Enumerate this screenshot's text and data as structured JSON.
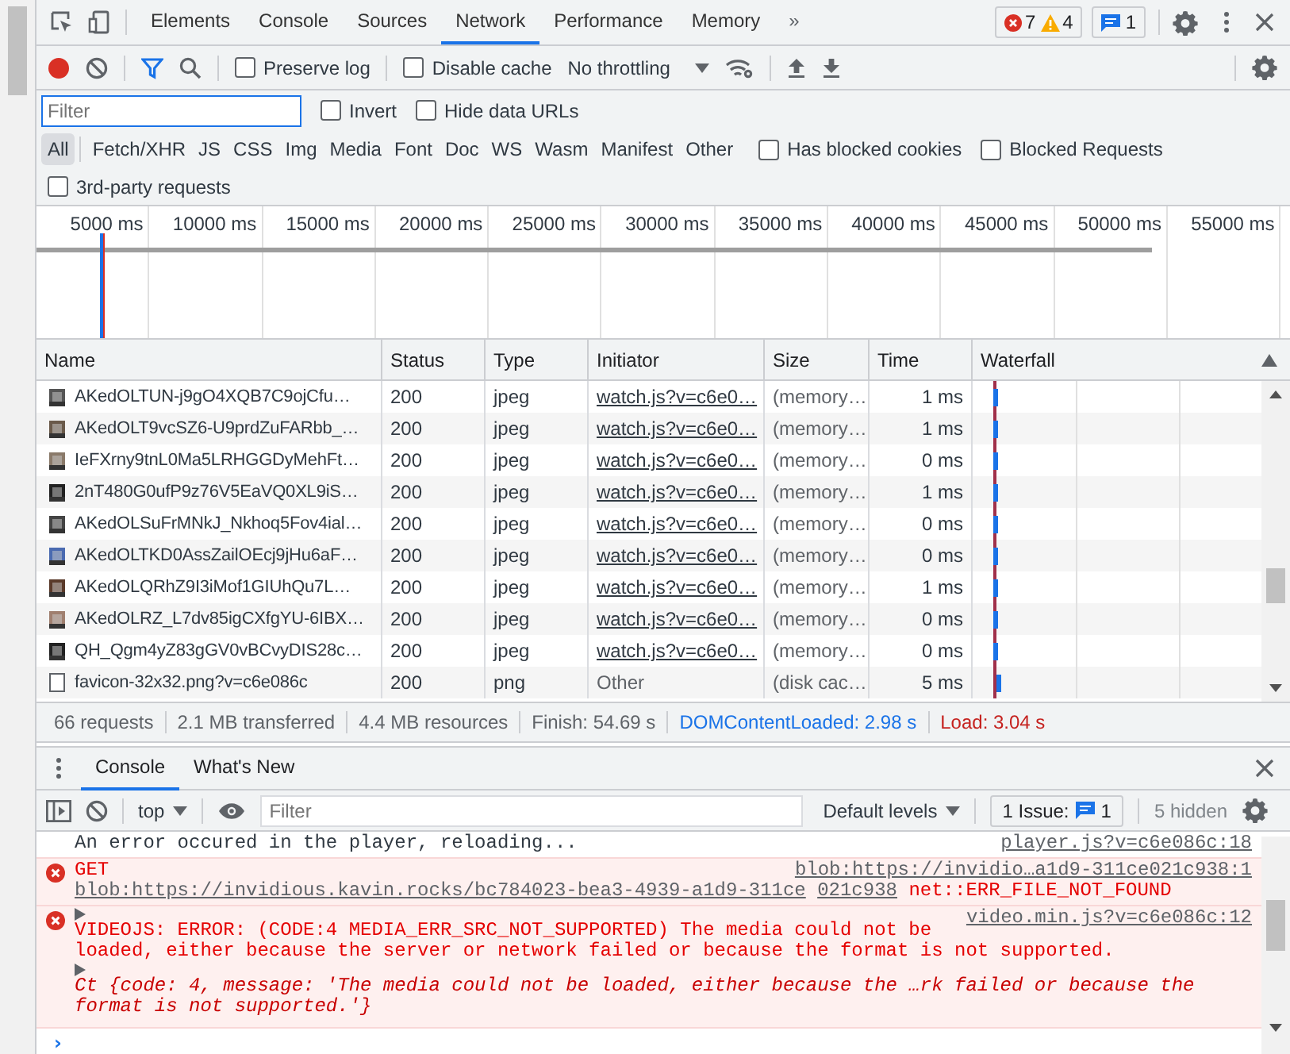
{
  "main_tabs": [
    {
      "label": "Elements",
      "selected": false
    },
    {
      "label": "Console",
      "selected": false
    },
    {
      "label": "Sources",
      "selected": false
    },
    {
      "label": "Network",
      "selected": true
    },
    {
      "label": "Performance",
      "selected": false
    },
    {
      "label": "Memory",
      "selected": false
    }
  ],
  "more_tabs": "»",
  "counts": {
    "errors": "7",
    "warnings": "4",
    "messages": "1"
  },
  "toolbar": {
    "recording": true,
    "filter_on": true,
    "preserve_log": {
      "label": "Preserve log",
      "checked": false
    },
    "disable_cache": {
      "label": "Disable cache",
      "checked": false
    },
    "throttling": "No throttling"
  },
  "filter": {
    "placeholder": "Filter",
    "invert": {
      "label": "Invert",
      "checked": false
    },
    "hide_data_urls": {
      "label": "Hide data URLs",
      "checked": false
    }
  },
  "type_filters": [
    {
      "label": "All",
      "selected": true
    },
    {
      "label": "Fetch/XHR",
      "selected": false
    },
    {
      "label": "JS",
      "selected": false
    },
    {
      "label": "CSS",
      "selected": false
    },
    {
      "label": "Img",
      "selected": false
    },
    {
      "label": "Media",
      "selected": false
    },
    {
      "label": "Font",
      "selected": false
    },
    {
      "label": "Doc",
      "selected": false
    },
    {
      "label": "WS",
      "selected": false
    },
    {
      "label": "Wasm",
      "selected": false
    },
    {
      "label": "Manifest",
      "selected": false
    },
    {
      "label": "Other",
      "selected": false
    }
  ],
  "blocked_cookies": {
    "label": "Has blocked cookies",
    "checked": false
  },
  "blocked_requests": {
    "label": "Blocked Requests",
    "checked": false
  },
  "third_party": {
    "label": "3rd-party requests",
    "checked": false
  },
  "overview": {
    "ticks": [
      "5000 ms",
      "10000 ms",
      "15000 ms",
      "20000 ms",
      "25000 ms",
      "30000 ms",
      "35000 ms",
      "40000 ms",
      "45000 ms",
      "50000 ms",
      "55000 ms"
    ]
  },
  "table": {
    "columns": [
      "Name",
      "Status",
      "Type",
      "Initiator",
      "Size",
      "Time",
      "Waterfall"
    ],
    "rows": [
      {
        "kind": "image",
        "name": "AKedOLTUN-j9gO4XQB7C9ojCfu…",
        "status": "200",
        "type": "jpeg",
        "initiator": "watch.js?v=c6e0…",
        "initiator_link": true,
        "size": "(memory…",
        "time": "1 ms"
      },
      {
        "kind": "image",
        "name": "AKedOLT9vcSZ6-U9prdZuFARbb_…",
        "status": "200",
        "type": "jpeg",
        "initiator": "watch.js?v=c6e0…",
        "initiator_link": true,
        "size": "(memory…",
        "time": "1 ms"
      },
      {
        "kind": "image",
        "name": "IeFXrny9tnL0Ma5LRHGGDyMehFt…",
        "status": "200",
        "type": "jpeg",
        "initiator": "watch.js?v=c6e0…",
        "initiator_link": true,
        "size": "(memory…",
        "time": "0 ms"
      },
      {
        "kind": "image",
        "name": "2nT480G0ufP9z76V5EaVQ0XL9iS…",
        "status": "200",
        "type": "jpeg",
        "initiator": "watch.js?v=c6e0…",
        "initiator_link": true,
        "size": "(memory…",
        "time": "1 ms"
      },
      {
        "kind": "image",
        "name": "AKedOLSuFrMNkJ_Nkhoq5Fov4ial…",
        "status": "200",
        "type": "jpeg",
        "initiator": "watch.js?v=c6e0…",
        "initiator_link": true,
        "size": "(memory…",
        "time": "0 ms"
      },
      {
        "kind": "image",
        "name": "AKedOLTKD0AssZailOEcj9jHu6aF…",
        "status": "200",
        "type": "jpeg",
        "initiator": "watch.js?v=c6e0…",
        "initiator_link": true,
        "size": "(memory…",
        "time": "0 ms"
      },
      {
        "kind": "image",
        "name": "AKedOLQRhZ9I3iMof1GIUhQu7L…",
        "status": "200",
        "type": "jpeg",
        "initiator": "watch.js?v=c6e0…",
        "initiator_link": true,
        "size": "(memory…",
        "time": "1 ms"
      },
      {
        "kind": "image",
        "name": "AKedOLRZ_L7dv85igCXfgYU-6IBX…",
        "status": "200",
        "type": "jpeg",
        "initiator": "watch.js?v=c6e0…",
        "initiator_link": true,
        "size": "(memory…",
        "time": "0 ms"
      },
      {
        "kind": "image",
        "name": "QH_Qgm4yZ83gGV0vBCvyDIS28c…",
        "status": "200",
        "type": "jpeg",
        "initiator": "watch.js?v=c6e0…",
        "initiator_link": true,
        "size": "(memory…",
        "time": "0 ms"
      },
      {
        "kind": "file",
        "name": "favicon-32x32.png?v=c6e086c",
        "status": "200",
        "type": "png",
        "initiator": "Other",
        "initiator_link": false,
        "size": "(disk cac…",
        "time": "5 ms"
      }
    ]
  },
  "status_bar": [
    {
      "text": "66 requests",
      "kind": "plain"
    },
    {
      "text": "2.1 MB transferred",
      "kind": "plain"
    },
    {
      "text": "4.4 MB resources",
      "kind": "plain"
    },
    {
      "text": "Finish: 54.69 s",
      "kind": "plain"
    },
    {
      "text": "DOMContentLoaded: 2.98 s",
      "kind": "dom"
    },
    {
      "text": "Load: 3.04 s",
      "kind": "load"
    }
  ],
  "drawer": {
    "tabs": [
      {
        "label": "Console",
        "selected": true
      },
      {
        "label": "What's New",
        "selected": false
      }
    ],
    "context": "top",
    "filter_placeholder": "Filter",
    "levels": "Default levels",
    "issues_label": "1 Issue:",
    "issues_count": "1",
    "hidden": "5 hidden"
  },
  "messages": [
    {
      "kind": "log",
      "text": "An error occured in the player, reloading...",
      "source": "player.js?v=c6e086c:18"
    },
    {
      "kind": "network_error",
      "method": "GET",
      "url_lines": [
        "blob:https://invidious.kavin.rocks/bc784023-bea3-4939-a1d9-311ce",
        "021c938"
      ],
      "text": "net::ERR_FILE_NOT_FOUND",
      "source": "blob:https://invidio…a1d9-311ce021c938:1"
    },
    {
      "kind": "error",
      "text": "VIDEOJS: ERROR: (CODE:4 MEDIA_ERR_SRC_NOT_SUPPORTED) The media could not be loaded, either because the server or network failed or because the format is not supported.",
      "source": "video.min.js?v=c6e086c:12",
      "expanded": false
    },
    {
      "kind": "object",
      "text": "Ct {code: 4, message: 'The media could not be loaded, either because the …rk failed or because the format is not supported.'}",
      "expanded": false
    }
  ],
  "prompt": "›"
}
